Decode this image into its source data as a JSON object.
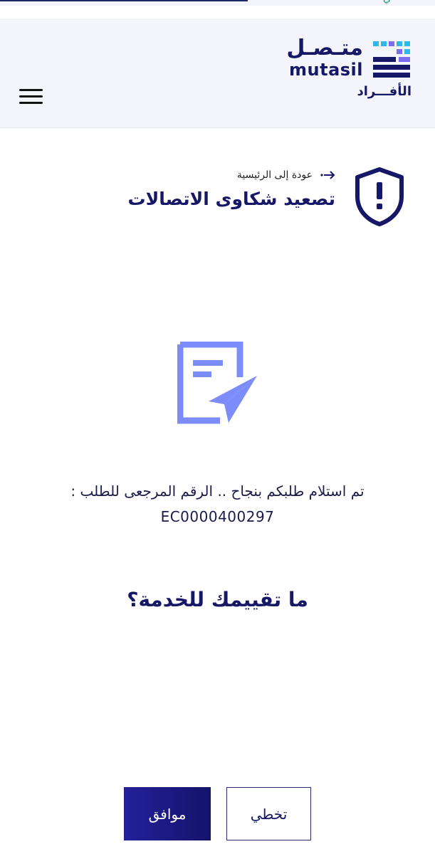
{
  "top_strip": {
    "fragment": "ي"
  },
  "header": {
    "logo_ar": "متـصـل",
    "logo_en": "mutasil",
    "logo_sub": "الأفـــراد"
  },
  "page": {
    "back_label": "عودة إلى الرئيسية",
    "title": "تصعيد شكاوى الاتصالات"
  },
  "confirmation": {
    "message": "تم استلام طلبكم بنجاح .. الرقم المرجعى للطلب :",
    "reference": "EC0000400297"
  },
  "rating": {
    "question": "ما تقييمك للخدمة؟"
  },
  "buttons": {
    "ok_label": "موافق",
    "skip_label": "تخطي"
  },
  "colors": {
    "brand": "#161766",
    "accent_icon": "#7c8cf8",
    "button_bg": "#1c1a85"
  },
  "icons": {
    "menu": "hamburger-icon",
    "back": "arrow-right-icon",
    "shield": "shield-alert-icon",
    "document": "document-send-icon"
  }
}
